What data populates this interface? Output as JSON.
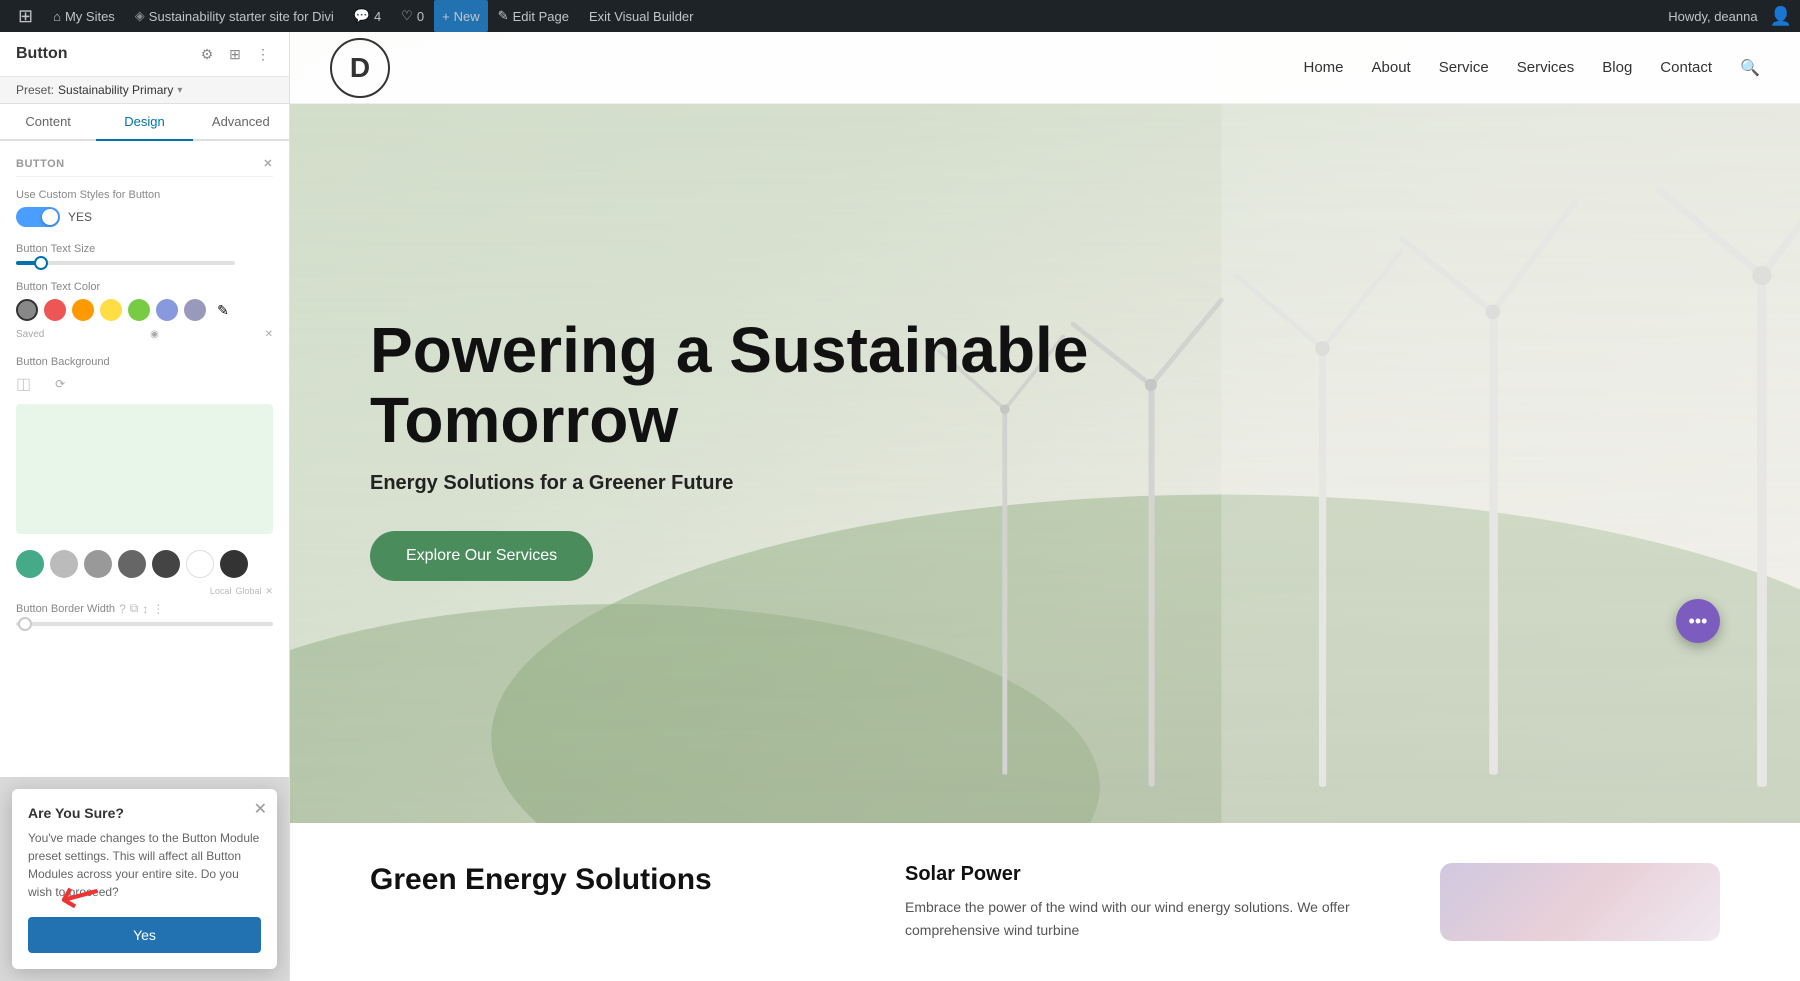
{
  "adminBar": {
    "wpIcon": "W",
    "mySites": "My Sites",
    "siteTitle": "Sustainability starter site for Divi",
    "comments": "4",
    "likes": "0",
    "new": "New",
    "editPage": "Edit Page",
    "exitVisualBuilder": "Exit Visual Builder",
    "howdy": "Howdy, deanna"
  },
  "panel": {
    "title": "Button",
    "preset": "Preset: Sustainability Primary",
    "tabs": [
      "Content",
      "Design",
      "Advanced"
    ],
    "activeTab": "Design",
    "sections": {
      "button": {
        "label": "Button",
        "customStylesLabel": "Use Custom Styles for Button",
        "textSizeLabel": "Button Text Size",
        "textColorLabel": "Button Text Color",
        "backgroundLabel": "Button Background",
        "borderWidthLabel": "Button Border Width"
      }
    },
    "savedLabel": "Saved",
    "globalLabel": "Global",
    "localLabel": "Local",
    "colors": {
      "gray": "#888888",
      "red": "#ee5555",
      "orange": "#ff9900",
      "yellow": "#ffdd44",
      "green": "#77cc44",
      "blueLight": "#8899dd",
      "purple": "#9999bb"
    }
  },
  "dialog": {
    "title": "Are You Sure?",
    "body": "You've made changes to the Button Module preset settings. This will affect all Button Modules across your entire site. Do you wish to proceed?",
    "yesLabel": "Yes"
  },
  "site": {
    "logoLetter": "D",
    "nav": {
      "home": "Home",
      "about": "About",
      "service": "Service",
      "services": "Services",
      "blog": "Blog",
      "contact": "Contact"
    },
    "hero": {
      "title": "Powering a Sustainable Tomorrow",
      "subtitle": "Energy Solutions for a Greener Future",
      "ctaButton": "Explore Our Services"
    },
    "bottom": {
      "greenEnergy": "Green Energy Solutions",
      "solarTitle": "Solar Power",
      "solarText": "Embrace the power of the wind with our wind energy solutions. We offer comprehensive wind turbine"
    }
  }
}
